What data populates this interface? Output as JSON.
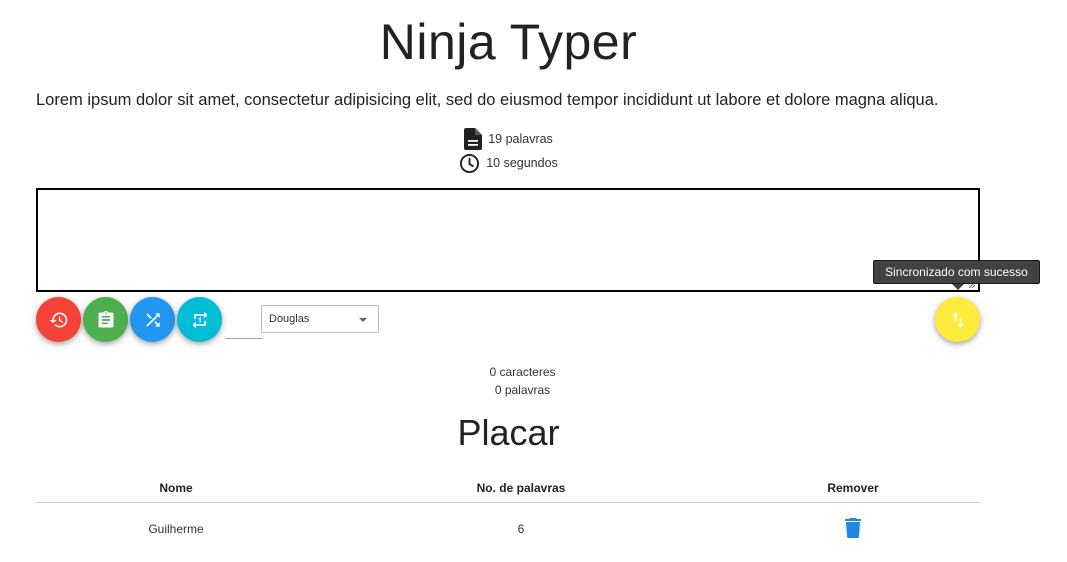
{
  "app": {
    "title": "Ninja Typer",
    "phrase": "Lorem ipsum dolor sit amet, consectetur adipisicing elit, sed do eiusmod tempor incididunt ut labore et dolore magna aliqua."
  },
  "info": {
    "word_count": "19 palavras",
    "time": "10 segundos"
  },
  "typing": {
    "value": ""
  },
  "controls": {
    "buttons": [
      {
        "name": "restart-button",
        "icon": "restore-icon",
        "color": "#f44336"
      },
      {
        "name": "clipboard-button",
        "icon": "clipboard-icon",
        "color": "#4caf50"
      },
      {
        "name": "shuffle-button",
        "icon": "shuffle-icon",
        "color": "#2196f3"
      },
      {
        "name": "repeat-button",
        "icon": "repeat-one-icon",
        "color": "#00bcd4"
      }
    ],
    "sync_button": {
      "icon": "swap-vert-icon",
      "color": "#ffeb3b"
    },
    "user_select": {
      "selected": "Douglas"
    },
    "tooltip": "Sincronizado com sucesso"
  },
  "counters": {
    "characters": "0 caracteres",
    "words": "0 palavras"
  },
  "scoreboard": {
    "title": "Placar",
    "columns": [
      "Nome",
      "No. de palavras",
      "Remover"
    ],
    "rows": [
      {
        "name": "Guilherme",
        "words": "6"
      }
    ],
    "remove_color": "#1e88e5"
  }
}
